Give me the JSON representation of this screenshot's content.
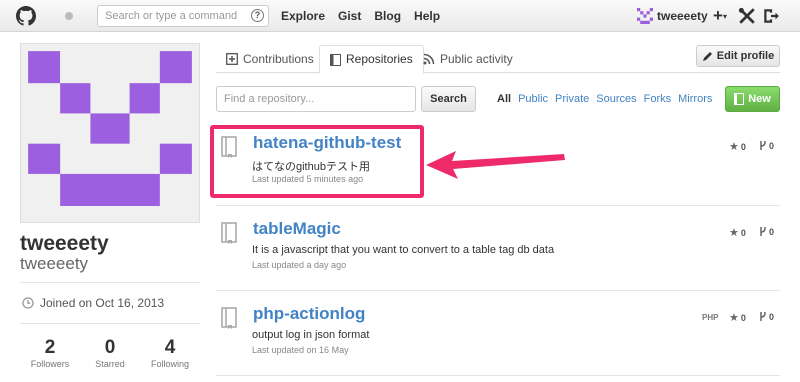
{
  "header": {
    "search_placeholder": "Search or type a command",
    "search_help": "?",
    "nav": [
      "Explore",
      "Gist",
      "Blog",
      "Help"
    ],
    "username": "tweeeety",
    "plus": "+"
  },
  "profile": {
    "fullname": "tweeeety",
    "login": "tweeeety",
    "joined": "Joined on Oct 16, 2013",
    "stats": [
      {
        "value": "2",
        "label": "Followers"
      },
      {
        "value": "0",
        "label": "Starred"
      },
      {
        "value": "4",
        "label": "Following"
      }
    ]
  },
  "tabs": [
    "Contributions",
    "Repositories",
    "Public activity"
  ],
  "edit_profile": "Edit profile",
  "find_placeholder": "Find a repository...",
  "search_button": "Search",
  "filters": [
    "All",
    "Public",
    "Private",
    "Sources",
    "Forks",
    "Mirrors"
  ],
  "new_button": "New",
  "repos": [
    {
      "name": "hatena-github-test",
      "desc": "はてなのgithubテスト用",
      "updated": "Last updated 5 minutes ago",
      "lang": "",
      "stars": "0",
      "forks": "0"
    },
    {
      "name": "tableMagic",
      "desc": "It is a javascript that you want to convert to a table tag db data",
      "updated": "Last updated a day ago",
      "lang": "",
      "stars": "0",
      "forks": "0"
    },
    {
      "name": "php-actionlog",
      "desc": "output log in json format",
      "updated": "Last updated on 16 May",
      "lang": "PHP",
      "stars": "0",
      "forks": "0"
    }
  ],
  "colors": {
    "accent": "#4183c4",
    "avatar": "#9b5fe0",
    "highlight": "#ee2a6b",
    "new_button": "#6cc644"
  }
}
